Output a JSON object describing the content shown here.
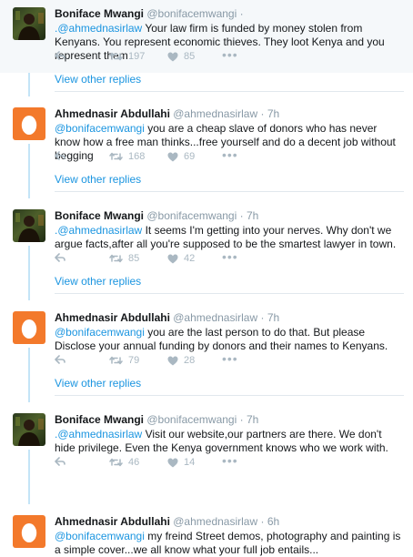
{
  "tweets": [
    {
      "avatar": "photo",
      "name": "Boniface Mwangi",
      "handle": "@bonifacemwangi",
      "time": "",
      "mention": ".@ahmednasirlaw",
      "text": " Your law firm is funded by money stolen from Kenyans. You represent economic thieves. They loot Kenya and you represent them",
      "retweets": "197",
      "likes": "85",
      "view_replies": "View other replies"
    },
    {
      "avatar": "egg",
      "name": "Ahmednasir Abdullahi",
      "handle": "@ahmednasirlaw",
      "time": "7h",
      "mention": "@bonifacemwangi",
      "text": " you are a cheap slave of donors who has never know how a free man thinks...free yourself and do a decent job without begging",
      "retweets": "168",
      "likes": "69",
      "view_replies": "View other replies"
    },
    {
      "avatar": "photo",
      "name": "Boniface Mwangi",
      "handle": "@bonifacemwangi",
      "time": "7h",
      "mention": ".@ahmednasirlaw",
      "text": " It seems I'm getting into your nerves. Why don't we argue facts,after all you're supposed to be the smartest lawyer in town.",
      "retweets": "85",
      "likes": "42",
      "view_replies": "View other replies"
    },
    {
      "avatar": "egg",
      "name": "Ahmednasir Abdullahi",
      "handle": "@ahmednasirlaw",
      "time": "7h",
      "mention": "@bonifacemwangi",
      "text": " you are the last person to do that. But please Disclose your annual funding by donors and their names to Kenyans.",
      "retweets": "79",
      "likes": "28",
      "view_replies": "View other replies"
    },
    {
      "avatar": "photo",
      "name": "Boniface Mwangi",
      "handle": "@bonifacemwangi",
      "time": "7h",
      "mention": ".@ahmednasirlaw",
      "text": " Visit our website,our partners are there. We don't hide privilege. Even the Kenya government knows who we work with.",
      "retweets": "46",
      "likes": "14",
      "view_replies": ""
    },
    {
      "avatar": "egg",
      "name": "Ahmednasir Abdullahi",
      "handle": "@ahmednasirlaw",
      "time": "6h",
      "mention": "@bonifacemwangi",
      "text": " my freind Street demos, photography and painting is a simple cover...we all know what your full job entails...",
      "retweets": "",
      "likes": "",
      "view_replies": ""
    }
  ],
  "icons": {
    "reply": "reply-arrow-icon",
    "retweet": "retweet-icon",
    "like": "heart-icon",
    "more": "more-dots-icon"
  },
  "colors": {
    "name": "#14171a",
    "meta": "#8899a6",
    "link": "#1b95e0",
    "action": "#aab8c2",
    "thread_line": "#c4e4f7",
    "egg": "#f3792b"
  }
}
